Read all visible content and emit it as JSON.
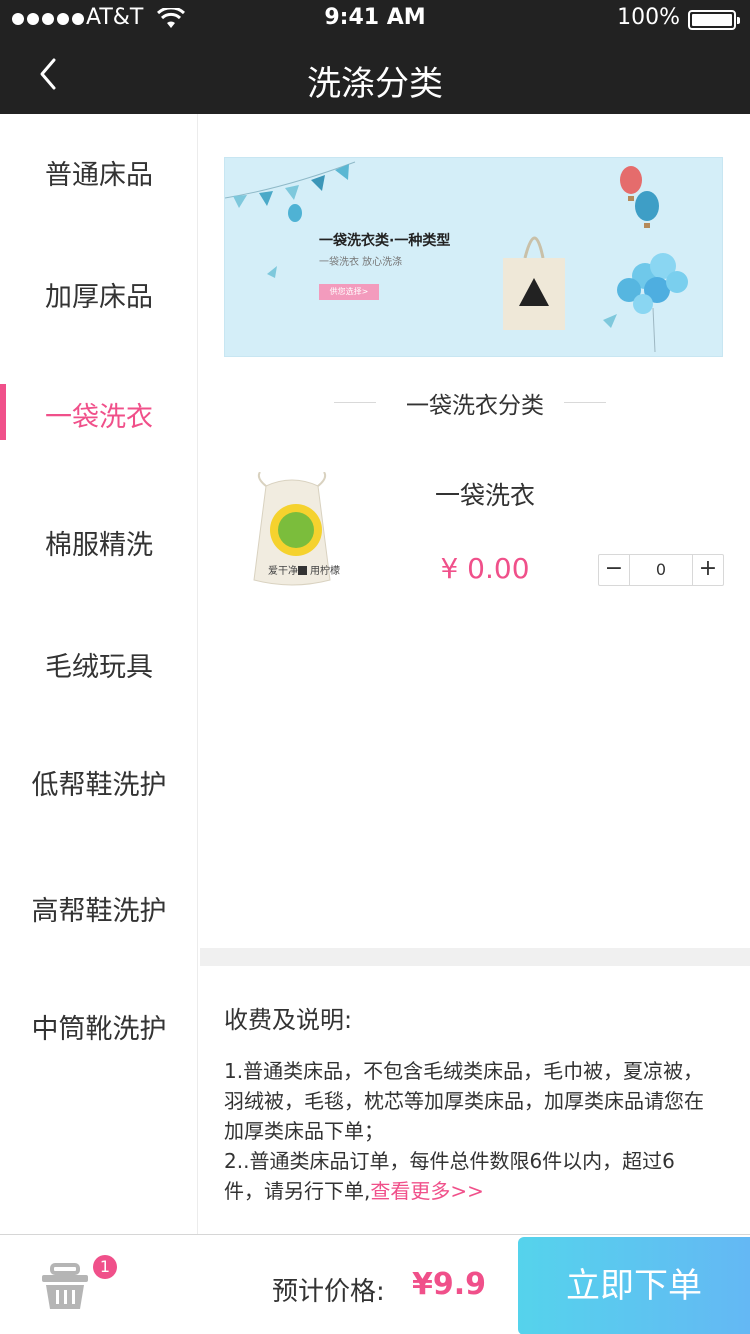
{
  "status": {
    "carrier": "AT&T",
    "time": "9:41 AM",
    "battery": "100%"
  },
  "nav": {
    "title": "洗涤分类"
  },
  "sidebar": {
    "active_index": 2,
    "items": [
      {
        "label": "普通床品"
      },
      {
        "label": "加厚床品"
      },
      {
        "label": "一袋洗衣"
      },
      {
        "label": "棉服精洗"
      },
      {
        "label": "毛绒玩具"
      },
      {
        "label": "低帮鞋洗护"
      },
      {
        "label": "高帮鞋洗护"
      },
      {
        "label": "中筒靴洗护"
      }
    ]
  },
  "banner": {
    "title": "一袋洗衣类·一种类型",
    "subtitle": "一袋洗衣   放心洗涤",
    "button": "供您选择>"
  },
  "section": {
    "title": "一袋洗衣分类"
  },
  "product": {
    "name": "一袋洗衣",
    "price": "¥ 0.00",
    "quantity": "0",
    "minus": "−",
    "plus": "+",
    "bag_text_left": "爱干净",
    "bag_text_right": "用柠檬"
  },
  "notes": {
    "title": "收费及说明:",
    "body": "1.普通类床品，不包含毛绒类床品，毛巾被，夏凉被，羽绒被，毛毯，枕芯等加厚类床品，加厚类床品请您在加厚类床品下单；\n2..普通类床品订单，每件总件数限6件以内，超过6件，请另行下单,",
    "more": "查看更多>>"
  },
  "footer": {
    "badge": "1",
    "estimate_label": "预计价格:",
    "estimate_value": "¥9.9",
    "order_button": "立即下单"
  },
  "colors": {
    "accent": "#f0508a",
    "topbar": "#222222",
    "button_gradient_start": "#55d3ec",
    "button_gradient_end": "#64b8f4"
  }
}
